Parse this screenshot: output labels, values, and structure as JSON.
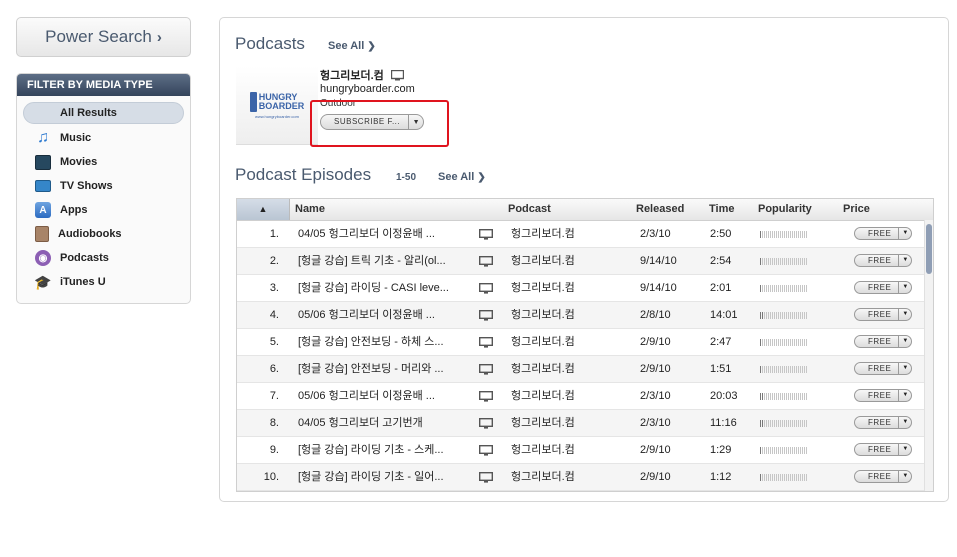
{
  "sidebar": {
    "power_search": {
      "label": "Power Search",
      "arrow": "›"
    },
    "filter": {
      "header": "FILTER BY MEDIA TYPE",
      "items": [
        {
          "label": "All Results",
          "icon": "none",
          "selected": true
        },
        {
          "label": "Music",
          "icon": "music-note-icon"
        },
        {
          "label": "Movies",
          "icon": "film-icon"
        },
        {
          "label": "TV Shows",
          "icon": "tv-icon"
        },
        {
          "label": "Apps",
          "icon": "app-store-icon"
        },
        {
          "label": "Audiobooks",
          "icon": "book-icon"
        },
        {
          "label": "Podcasts",
          "icon": "podcast-icon"
        },
        {
          "label": "iTunes U",
          "icon": "graduation-cap-icon"
        }
      ]
    }
  },
  "podcasts_section": {
    "title": "Podcasts",
    "see_all": "See All",
    "podcast": {
      "artwork_text": {
        "line1": "HUNGRY",
        "line2": "BOARDER",
        "url": "www.hungryboarder.com"
      },
      "title": "헝그리보더.컴",
      "url": "hungryboarder.com",
      "category": "Outdoor",
      "subscribe_label": "SUBSCRIBE F...",
      "dropdown_arrow": "▼"
    }
  },
  "episodes_section": {
    "title": "Podcast Episodes",
    "range": "1-50",
    "see_all": "See All",
    "columns": {
      "sort": "▲",
      "name": "Name",
      "podcast": "Podcast",
      "released": "Released",
      "time": "Time",
      "popularity": "Popularity",
      "price": "Price"
    },
    "rows": [
      {
        "num": "1.",
        "name": "04/05 헝그리보더 이정윤배 ...",
        "podcast": "헝그리보더.컴",
        "released": "2/3/10",
        "time": "2:50",
        "popularity": 0.05,
        "price": "FREE"
      },
      {
        "num": "2.",
        "name": "[헝글 강습] 트릭 기초 - 알리(ol...",
        "podcast": "헝그리보더.컴",
        "released": "9/14/10",
        "time": "2:54",
        "popularity": 0.05,
        "price": "FREE"
      },
      {
        "num": "3.",
        "name": "[헝글 강습] 라이딩 - CASI leve...",
        "podcast": "헝그리보더.컴",
        "released": "9/14/10",
        "time": "2:01",
        "popularity": 0.05,
        "price": "FREE"
      },
      {
        "num": "4.",
        "name": "05/06 헝그리보더 이정윤배 ...",
        "podcast": "헝그리보더.컴",
        "released": "2/8/10",
        "time": "14:01",
        "popularity": 0.1,
        "price": "FREE"
      },
      {
        "num": "5.",
        "name": "[헝글 강습] 안전보딩 - 하체 스...",
        "podcast": "헝그리보더.컴",
        "released": "2/9/10",
        "time": "2:47",
        "popularity": 0.05,
        "price": "FREE"
      },
      {
        "num": "6.",
        "name": "[헝글 강습] 안전보딩 - 머리와 ...",
        "podcast": "헝그리보더.컴",
        "released": "2/9/10",
        "time": "1:51",
        "popularity": 0.05,
        "price": "FREE"
      },
      {
        "num": "7.",
        "name": "05/06 헝그리보더 이정윤배 ...",
        "podcast": "헝그리보더.컴",
        "released": "2/3/10",
        "time": "20:03",
        "popularity": 0.1,
        "price": "FREE"
      },
      {
        "num": "8.",
        "name": "04/05 헝그리보더 고기번개",
        "podcast": "헝그리보더.컴",
        "released": "2/3/10",
        "time": "11:16",
        "popularity": 0.1,
        "price": "FREE"
      },
      {
        "num": "9.",
        "name": "[헝글 강습] 라이딩 기초 - 스케...",
        "podcast": "헝그리보더.컴",
        "released": "2/9/10",
        "time": "1:29",
        "popularity": 0.05,
        "price": "FREE"
      },
      {
        "num": "10.",
        "name": "[헝글 강습] 라이딩 기초 - 일어...",
        "podcast": "헝그리보더.컴",
        "released": "2/9/10",
        "time": "1:12",
        "popularity": 0.05,
        "price": "FREE"
      }
    ]
  },
  "colors": {
    "accent_header": "#34445b",
    "highlight_box": "#e0141e",
    "title_text": "#4a5a6f"
  }
}
